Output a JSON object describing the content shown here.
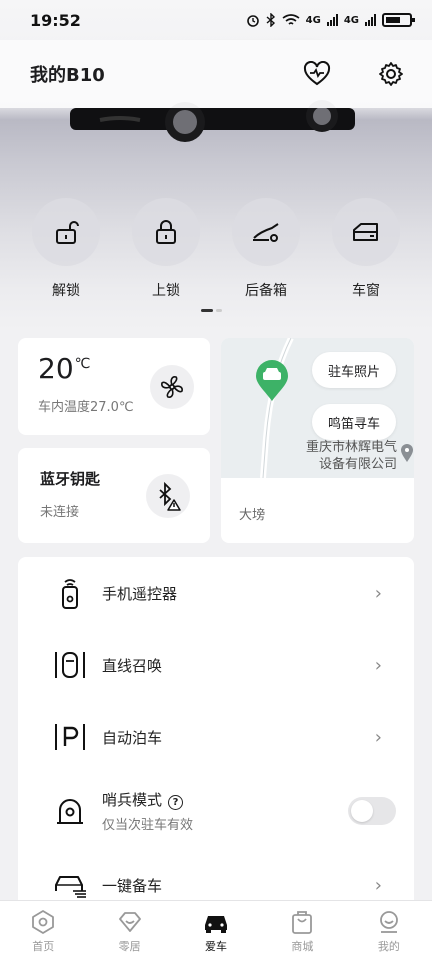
{
  "status_bar": {
    "time": "19:52",
    "net1": "4G",
    "net2": "4G"
  },
  "header": {
    "title": "我的B10",
    "health_icon": "heart-pulse-icon",
    "settings_icon": "gear-icon"
  },
  "controls": [
    {
      "label": "解锁",
      "icon": "unlock-icon"
    },
    {
      "label": "上锁",
      "icon": "lock-icon"
    },
    {
      "label": "后备箱",
      "icon": "trunk-icon"
    },
    {
      "label": "车窗",
      "icon": "window-icon"
    }
  ],
  "pager": {
    "pages": 2,
    "active": 0
  },
  "climate": {
    "temp": "20",
    "unit": "℃",
    "inside_label": "车内温度27.0℃"
  },
  "bluetooth_key": {
    "title": "蓝牙钥匙",
    "status": "未连接"
  },
  "map": {
    "photo_button": "驻车照片",
    "honk_button": "鸣笛寻车",
    "poi_line1": "重庆市林辉电气",
    "poi_line2": "设备有限公司",
    "location": "大塝"
  },
  "features": [
    {
      "label": "手机遥控器",
      "icon": "remote-icon",
      "action": "chevron"
    },
    {
      "label": "直线召唤",
      "icon": "summon-icon",
      "action": "chevron"
    },
    {
      "label": "自动泊车",
      "icon": "parking-icon",
      "action": "chevron"
    },
    {
      "label": "哨兵模式",
      "sub": "仅当次驻车有效",
      "icon": "sentry-icon",
      "action": "toggle",
      "toggle_on": false
    },
    {
      "label": "一键备车",
      "icon": "car-prep-icon",
      "action": "chevron"
    }
  ],
  "tabs": [
    {
      "label": "首页",
      "icon": "home-icon",
      "active": false
    },
    {
      "label": "零居",
      "icon": "heart-home-icon",
      "active": false
    },
    {
      "label": "爱车",
      "icon": "car-icon",
      "active": true
    },
    {
      "label": "商城",
      "icon": "shopping-bag-icon",
      "active": false
    },
    {
      "label": "我的",
      "icon": "profile-icon",
      "active": false
    }
  ],
  "colors": {
    "accent": "#111111",
    "map_pin": "#3db267",
    "muted": "#999999"
  }
}
